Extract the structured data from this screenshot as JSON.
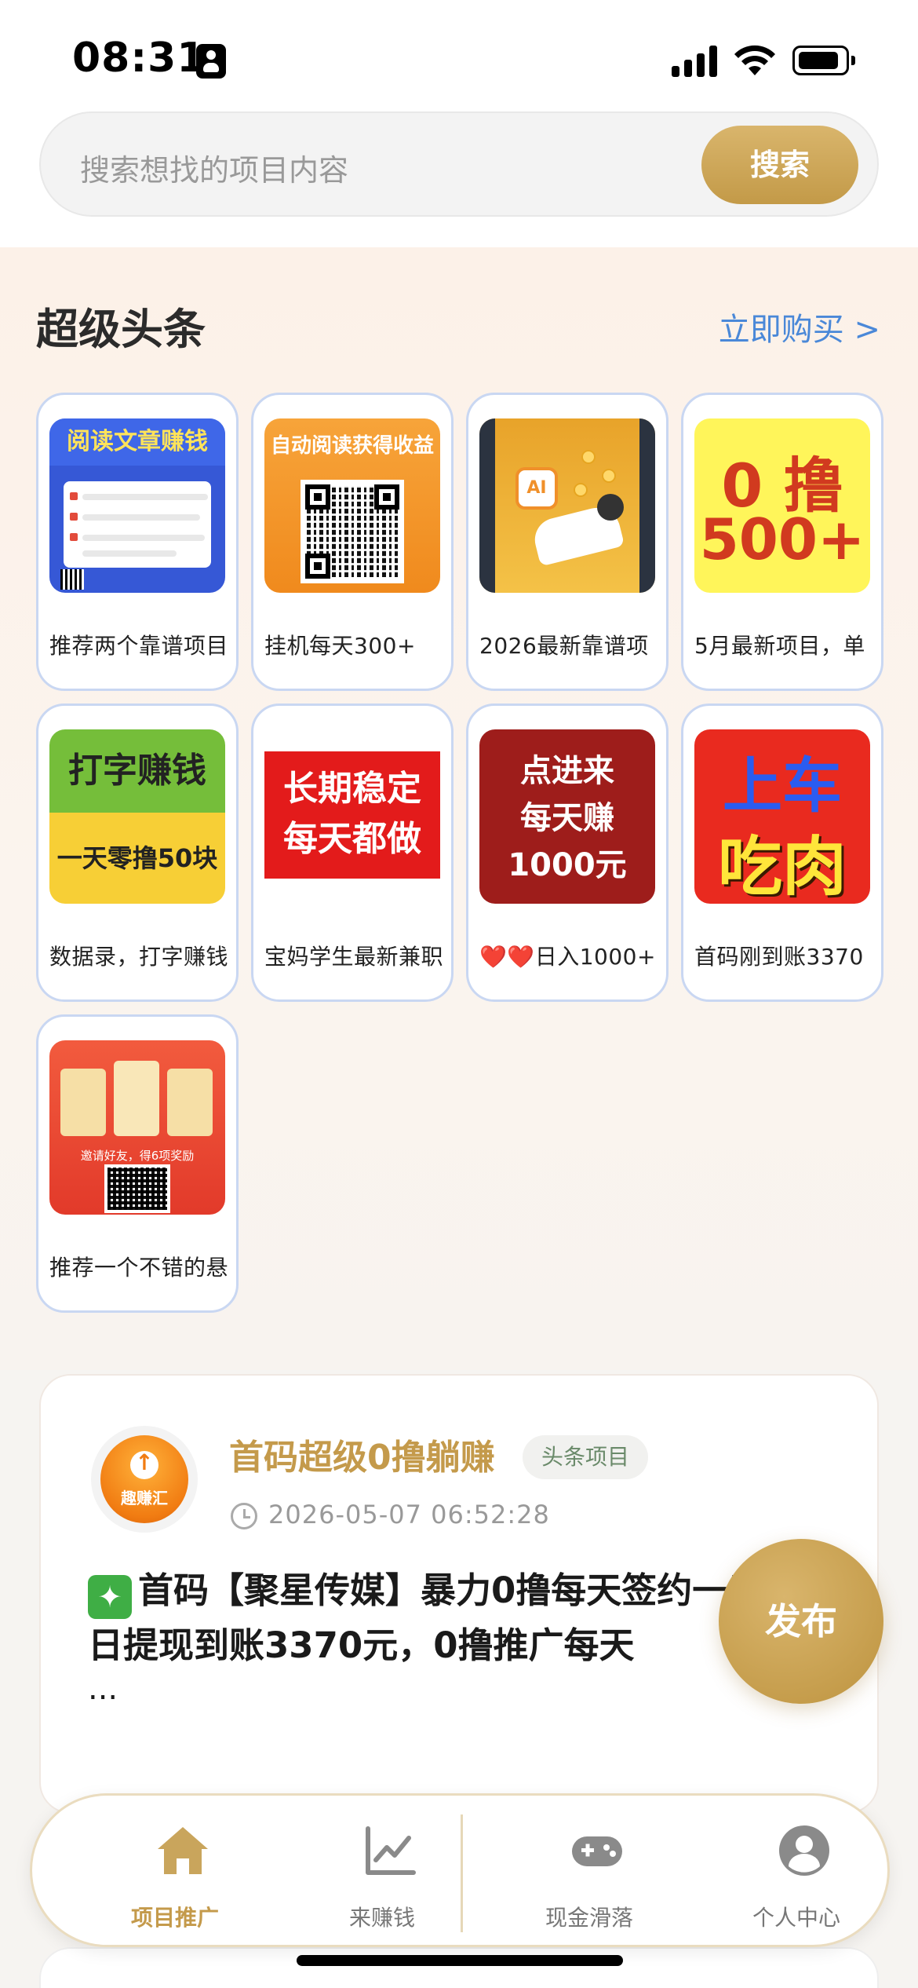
{
  "status_bar": {
    "time": "08:31"
  },
  "search": {
    "placeholder": "搜索想找的项目内容",
    "button_label": "搜索"
  },
  "headline": {
    "title": "超级头条",
    "buy_link": "立即购买 >",
    "cards": [
      {
        "label": "推荐两个靠谱项目",
        "image_text": [
          "阅读文章赚钱"
        ]
      },
      {
        "label": "挂机每天300+",
        "image_text": [
          "自动阅读获得收益"
        ]
      },
      {
        "label": "2026最新靠谱项",
        "image_text": [
          "AI"
        ]
      },
      {
        "label": "5月最新项目，单",
        "image_text": [
          "0 撸",
          "500+"
        ]
      },
      {
        "label": "数据录，打字赚钱",
        "image_text": [
          "打字赚钱",
          "一天零撸50块"
        ]
      },
      {
        "label": "宝妈学生最新兼职",
        "image_text": [
          "长期稳定",
          "每天都做"
        ]
      },
      {
        "label": "❤️❤️日入1000+",
        "image_text": [
          "点进来",
          "每天赚",
          "1000元"
        ]
      },
      {
        "label": "首码刚到账3370",
        "image_text": [
          "上车",
          "吃肉"
        ]
      },
      {
        "label": "推荐一个不错的悬",
        "image_text": [
          "邀请好友，得6项奖励"
        ]
      }
    ]
  },
  "post": {
    "avatar_text": "趣赚汇",
    "title": "首码超级0撸躺赚",
    "tag": "头条项目",
    "time": "2026-05-07 06:52:28",
    "body": "首码【聚星传媒】暴力0撸每天签约一元，今日提现到账3370元，0撸推广每天",
    "ellipsis": "..."
  },
  "fab": {
    "label": "发布"
  },
  "tab_bar": {
    "tabs": [
      {
        "label": "项目推广",
        "icon": "home-icon",
        "active": true
      },
      {
        "label": "来赚钱",
        "icon": "chart-icon",
        "active": false
      },
      {
        "label": "现金滑落",
        "icon": "gamepad-icon",
        "active": false
      },
      {
        "label": "个人中心",
        "icon": "user-icon",
        "active": false
      }
    ]
  },
  "colors": {
    "accent_gold": "#c49a4b",
    "link_blue": "#4a88d8",
    "card_border": "#c9d7f2"
  }
}
